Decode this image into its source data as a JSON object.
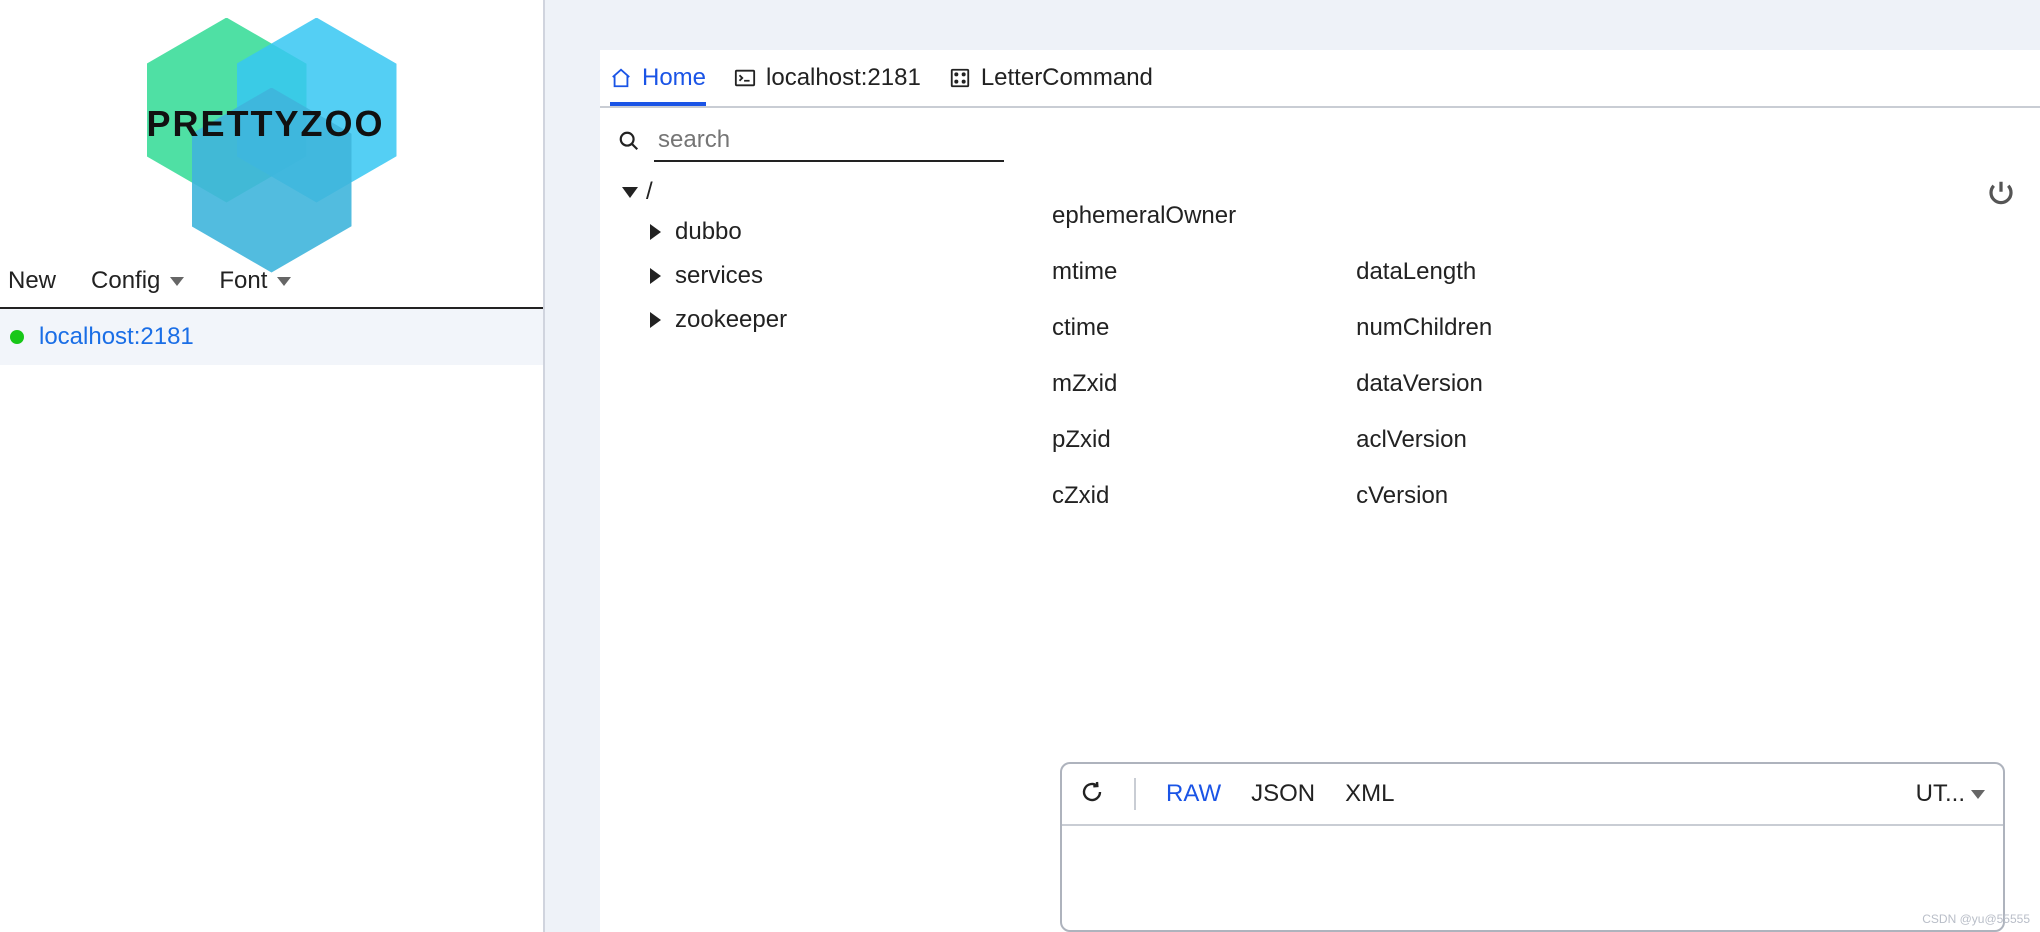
{
  "app": {
    "logoText": "PRETTYZOO"
  },
  "menu": {
    "new": "New",
    "config": "Config",
    "font": "Font"
  },
  "servers": [
    {
      "name": "localhost:2181",
      "status": "connected"
    }
  ],
  "tabs": {
    "home": "Home",
    "terminal": "localhost:2181",
    "letter": "LetterCommand"
  },
  "search": {
    "placeholder": "search"
  },
  "tree": {
    "root": "/",
    "children": [
      "dubbo",
      "services",
      "zookeeper"
    ]
  },
  "stat": {
    "col1": [
      "ephemeralOwner",
      "mtime",
      "ctime",
      "mZxid",
      "pZxid",
      "cZxid"
    ],
    "col2": [
      "dataLength",
      "numChildren",
      "dataVersion",
      "aclVersion",
      "cVersion"
    ]
  },
  "dataPanel": {
    "formats": {
      "raw": "RAW",
      "json": "JSON",
      "xml": "XML"
    },
    "encoding": "UT..."
  },
  "watermark": "CSDN @yu@55555"
}
